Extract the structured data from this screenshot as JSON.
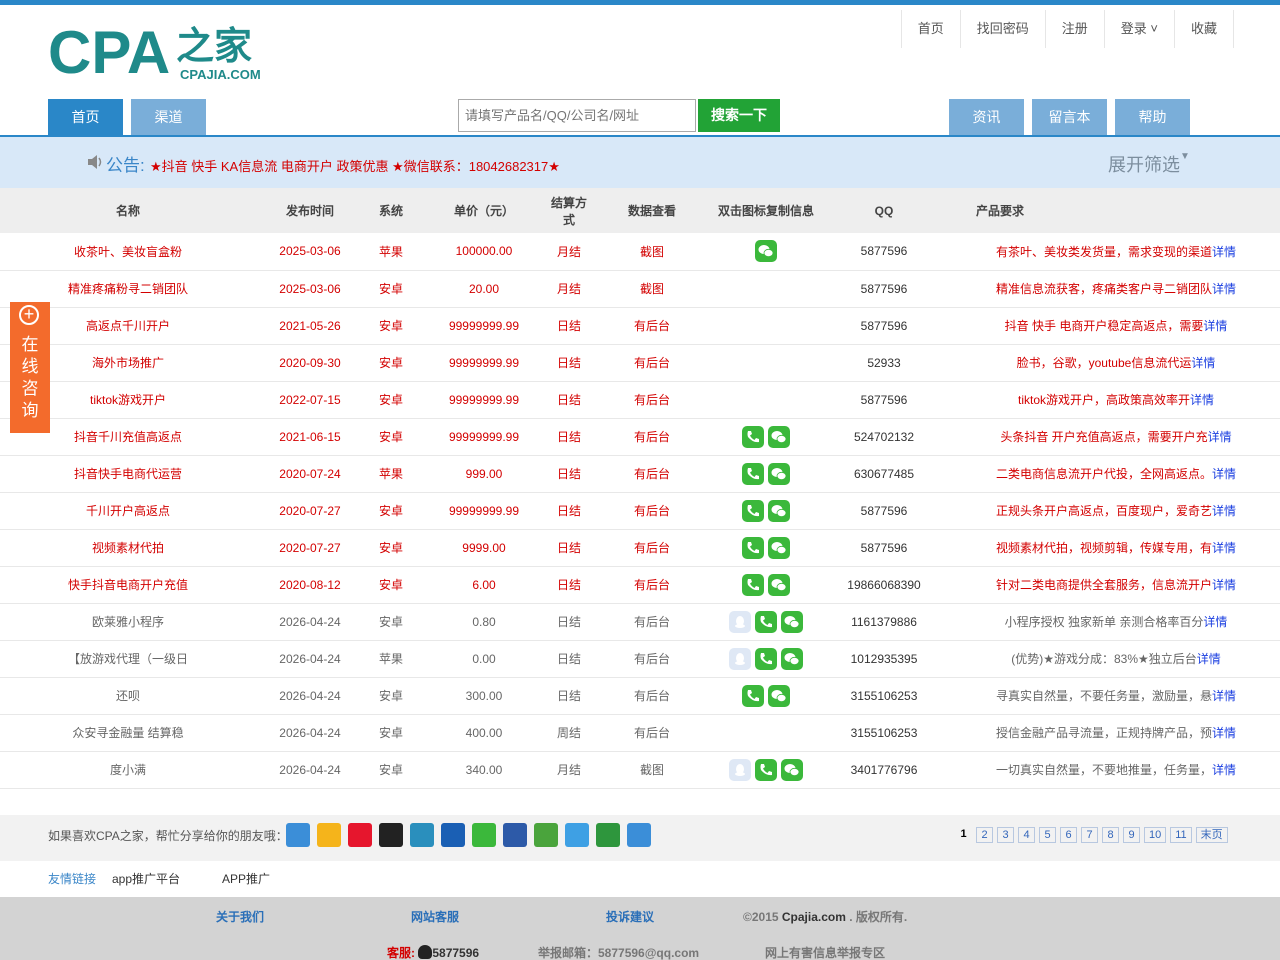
{
  "brand": {
    "logo_text": "CPA",
    "logo_cn": "之家",
    "logo_sub": "CPAJIA.COM"
  },
  "toplinks": [
    "首页",
    "找回密码",
    "注册",
    "登录 ˅",
    "收藏"
  ],
  "nav_left": [
    "首页",
    "渠道"
  ],
  "search": {
    "placeholder": "请填写产品名/QQ/公司名/网址",
    "button": "搜索一下"
  },
  "nav_right": [
    "资讯",
    "留言本",
    "帮助"
  ],
  "notice": {
    "label": "公告:",
    "text": "★抖音 快手 KA信息流 电商开户 政策优惠 ★微信联系：18042682317★",
    "filter": "展开筛选"
  },
  "table": {
    "headers": [
      "名称",
      "发布时间",
      "系统",
      "单价（元）",
      "结算方式",
      "数据查看",
      "双击图标复制信息",
      "QQ",
      "产品要求"
    ],
    "detail_label": "详情",
    "rows": [
      {
        "name": "收茶叶、美妆盲盒粉",
        "date": "2025-03-06",
        "sys": "苹果",
        "price": "100000.00",
        "settle": "月结",
        "data": "截图",
        "icons": [
          "wx"
        ],
        "qq": "5877596",
        "req": "有茶叶、美妆类发货量，需求变现的渠道",
        "hot": true
      },
      {
        "name": "精准疼痛粉寻二销团队",
        "date": "2025-03-06",
        "sys": "安卓",
        "price": "20.00",
        "settle": "月结",
        "data": "截图",
        "icons": [],
        "qq": "5877596",
        "req": "精准信息流获客，疼痛类客户寻二销团队",
        "hot": true
      },
      {
        "name": "高返点千川开户",
        "date": "2021-05-26",
        "sys": "安卓",
        "price": "99999999.99",
        "settle": "日结",
        "data": "有后台",
        "icons": [],
        "qq": "5877596",
        "req": "抖音 快手 电商开户稳定高返点，需要",
        "hot": true
      },
      {
        "name": "海外市场推广",
        "date": "2020-09-30",
        "sys": "安卓",
        "price": "99999999.99",
        "settle": "日结",
        "data": "有后台",
        "icons": [],
        "qq": "52933",
        "req": "脸书，谷歌，youtube信息流代运",
        "hot": true
      },
      {
        "name": "tiktok游戏开户",
        "date": "2022-07-15",
        "sys": "安卓",
        "price": "99999999.99",
        "settle": "日结",
        "data": "有后台",
        "icons": [],
        "qq": "5877596",
        "req": "tiktok游戏开户，高政策高效率开",
        "hot": true
      },
      {
        "name": "抖音千川充值高返点",
        "date": "2021-06-15",
        "sys": "安卓",
        "price": "99999999.99",
        "settle": "日结",
        "data": "有后台",
        "icons": [
          "phone",
          "wx"
        ],
        "qq": "524702132",
        "req": "头条抖音 开户充值高返点，需要开户充",
        "hot": true
      },
      {
        "name": "抖音快手电商代运营",
        "date": "2020-07-24",
        "sys": "苹果",
        "price": "999.00",
        "settle": "日结",
        "data": "有后台",
        "icons": [
          "phone",
          "wx"
        ],
        "qq": "630677485",
        "req": "二类电商信息流开户代投，全网高返点。",
        "hot": true
      },
      {
        "name": "千川开户高返点",
        "date": "2020-07-27",
        "sys": "安卓",
        "price": "99999999.99",
        "settle": "日结",
        "data": "有后台",
        "icons": [
          "phone",
          "wx"
        ],
        "qq": "5877596",
        "req": "正规头条开户高返点，百度现户，爱奇艺",
        "hot": true
      },
      {
        "name": "视频素材代拍",
        "date": "2020-07-27",
        "sys": "安卓",
        "price": "9999.00",
        "settle": "日结",
        "data": "有后台",
        "icons": [
          "phone",
          "wx"
        ],
        "qq": "5877596",
        "req": "视频素材代拍，视频剪辑，传媒专用，有",
        "hot": true
      },
      {
        "name": "快手抖音电商开户充值",
        "date": "2020-08-12",
        "sys": "安卓",
        "price": "6.00",
        "settle": "日结",
        "data": "有后台",
        "icons": [
          "phone",
          "wx"
        ],
        "qq": "19866068390",
        "req": "针对二类电商提供全套服务，信息流开户",
        "hot": true
      },
      {
        "name": "欧莱雅小程序",
        "date": "2026-04-24",
        "sys": "安卓",
        "price": "0.80",
        "settle": "日结",
        "data": "有后台",
        "icons": [
          "qq",
          "phone",
          "wx"
        ],
        "qq": "1161379886",
        "req": "小程序授权 独家新单 亲测合格率百分",
        "hot": false
      },
      {
        "name": "【放游戏代理（一级日",
        "date": "2026-04-24",
        "sys": "苹果",
        "price": "0.00",
        "settle": "日结",
        "data": "有后台",
        "icons": [
          "qq",
          "phone",
          "wx"
        ],
        "qq": "1012935395",
        "req": "(优势)★游戏分成：83%★独立后台",
        "hot": false
      },
      {
        "name": "还呗",
        "date": "2026-04-24",
        "sys": "安卓",
        "price": "300.00",
        "settle": "日结",
        "data": "有后台",
        "icons": [
          "phone",
          "wx"
        ],
        "qq": "3155106253",
        "req": "寻真实自然量，不要任务量，激励量，悬",
        "hot": false
      },
      {
        "name": "众安寻金融量 结算稳",
        "date": "2026-04-24",
        "sys": "安卓",
        "price": "400.00",
        "settle": "周结",
        "data": "有后台",
        "icons": [],
        "qq": "3155106253",
        "req": "授信金融产品寻流量，正规持牌产品，预",
        "hot": false
      },
      {
        "name": "度小满",
        "date": "2026-04-24",
        "sys": "安卓",
        "price": "340.00",
        "settle": "月结",
        "data": "截图",
        "icons": [
          "qq",
          "phone",
          "wx"
        ],
        "qq": "3401776796",
        "req": "一切真实自然量，不要地推量，任务量，",
        "hot": false
      }
    ]
  },
  "consult": {
    "text": "在线咨询"
  },
  "share": {
    "text": "如果喜欢CPA之家，帮忙分享给你的朋友哦："
  },
  "pager": [
    "1",
    "2",
    "3",
    "4",
    "5",
    "6",
    "7",
    "8",
    "9",
    "10",
    "11",
    "末页"
  ],
  "links": {
    "label": "友情链接",
    "items": [
      "app推广平台",
      "APP推广"
    ]
  },
  "footer": {
    "about": "关于我们",
    "service": "网站客服",
    "complaint": "投诉建议",
    "copyright_pre": "©2015 ",
    "copyright_site": "Cpajia.com",
    "copyright_post": " . 版权所有.",
    "kefu_label": "客服:",
    "kefu_qq": "5877596",
    "report_email": "举报邮箱：5877596@qq.com",
    "report_zone": "网上有害信息举报专区"
  },
  "colors": {
    "accent": "#2a87c8",
    "hot_text": "#d30000",
    "search_green": "#22a336",
    "consult_orange": "#f36b2c"
  }
}
